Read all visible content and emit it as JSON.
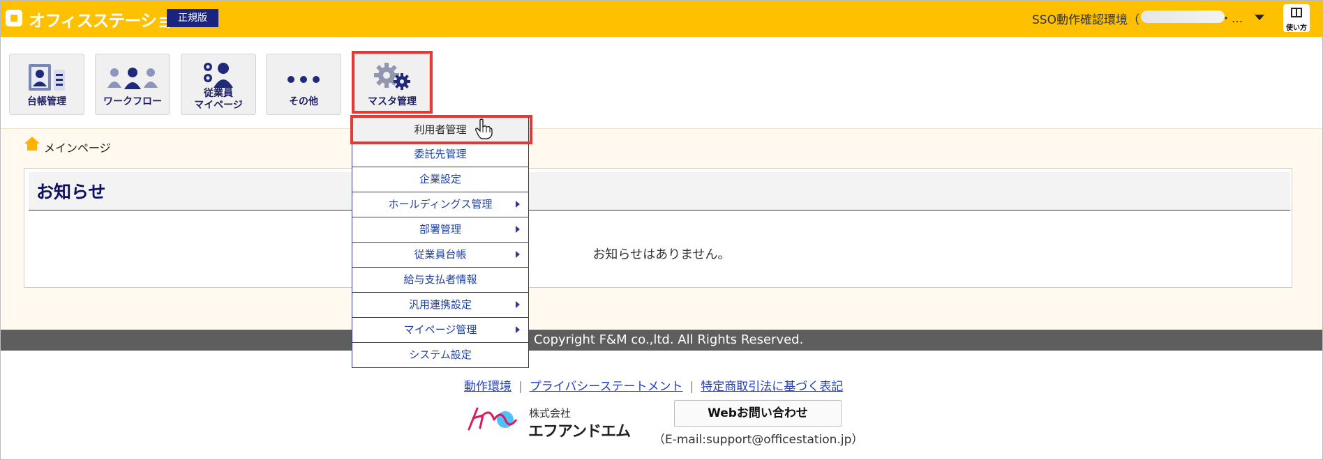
{
  "header": {
    "app_name": "オフィスステーション",
    "edition": "正規版",
    "environment": "SSO動作確認環境（",
    "environment_suffix": "・…",
    "help_label": "使い方"
  },
  "nav": {
    "tiles": [
      {
        "label": "台帳管理"
      },
      {
        "label": "ワークフロー"
      },
      {
        "label": "従業員マイページ",
        "label_line1": "従業員",
        "label_line2": "マイページ"
      },
      {
        "label": "その他"
      },
      {
        "label": "マスタ管理"
      }
    ]
  },
  "master_menu": {
    "items": [
      {
        "label": "利用者管理",
        "submenu": false
      },
      {
        "label": "委託先管理",
        "submenu": false
      },
      {
        "label": "企業設定",
        "submenu": false
      },
      {
        "label": "ホールディングス管理",
        "submenu": true
      },
      {
        "label": "部署管理",
        "submenu": true
      },
      {
        "label": "従業員台帳",
        "submenu": true
      },
      {
        "label": "給与支払者情報",
        "submenu": false
      },
      {
        "label": "汎用連携設定",
        "submenu": true
      },
      {
        "label": "マイページ管理",
        "submenu": true
      },
      {
        "label": "システム設定",
        "submenu": false
      }
    ]
  },
  "breadcrumb": {
    "label": "メインページ"
  },
  "notice": {
    "title": "お知らせ",
    "empty_message": "お知らせはありません。"
  },
  "footer": {
    "copyright": "Copyright F&M co.,ltd. All Rights Reserved.",
    "links": [
      "動作環境",
      "プライバシーステートメント",
      "特定商取引法に基づく表記"
    ],
    "company_prefix": "株式会社",
    "company_name": "エフアンドエム",
    "contact_button": "Webお問い合わせ",
    "contact_email": "（E-mail:support@officestation.jp）"
  },
  "colors": {
    "header_bg": "#ffc000",
    "brand_navy": "#1a237e",
    "highlight_red": "#e53935",
    "link_blue": "#1f3fbf"
  },
  "icons": [
    "app-logo-icon",
    "caret-down-icon",
    "book-icon",
    "ledger-icon",
    "workflow-icon",
    "employee-mypage-icon",
    "more-dots-icon",
    "gears-icon",
    "home-icon",
    "submenu-arrow-icon",
    "pointer-hand-icon",
    "fm-logo-icon"
  ]
}
